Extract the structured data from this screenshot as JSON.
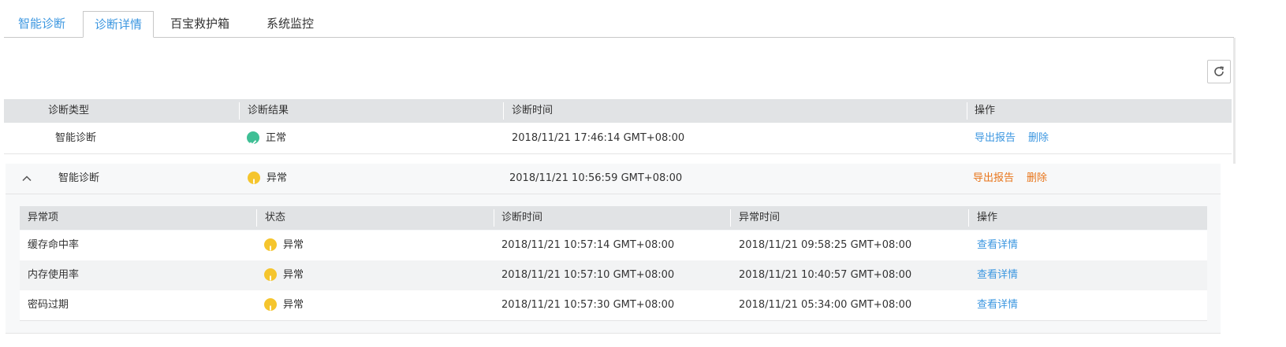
{
  "tabs": [
    {
      "label": "智能诊断"
    },
    {
      "label": "诊断详情"
    },
    {
      "label": "百宝救护箱"
    },
    {
      "label": "系统监控"
    }
  ],
  "main_table": {
    "headers": [
      "诊断类型",
      "诊断结果",
      "诊断时间",
      "操作"
    ],
    "rows": [
      {
        "type": "智能诊断",
        "result": "正常",
        "time": "2018/11/21 17:46:14 GMT+08:00",
        "export": "导出报告",
        "delete": "删除"
      },
      {
        "type": "智能诊断",
        "result": "异常",
        "time": "2018/11/21 10:56:59 GMT+08:00",
        "export": "导出报告",
        "delete": "删除"
      }
    ]
  },
  "detail_table": {
    "headers": [
      "异常项",
      "状态",
      "诊断时间",
      "异常时间",
      "操作"
    ],
    "rows": [
      {
        "item": "缓存命中率",
        "status": "异常",
        "diag_time": "2018/11/21 10:57:14 GMT+08:00",
        "abn_time": "2018/11/21 09:58:25 GMT+08:00",
        "action": "查看详情"
      },
      {
        "item": "内存使用率",
        "status": "异常",
        "diag_time": "2018/11/21 10:57:10 GMT+08:00",
        "abn_time": "2018/11/21 10:40:57 GMT+08:00",
        "action": "查看详情"
      },
      {
        "item": "密码过期",
        "status": "异常",
        "diag_time": "2018/11/21 10:57:30 GMT+08:00",
        "abn_time": "2018/11/21 05:34:00 GMT+08:00",
        "action": "查看详情"
      }
    ]
  },
  "colors": {
    "link": "#3c97e0",
    "accent_orange": "#e8751a",
    "ok": "#3fbf95",
    "warn": "#f5c52d"
  },
  "icons": {
    "refresh": "refresh-icon",
    "collapse": "chevron-up-icon",
    "ok": "check-circle-icon",
    "warn": "exclamation-circle-icon"
  }
}
